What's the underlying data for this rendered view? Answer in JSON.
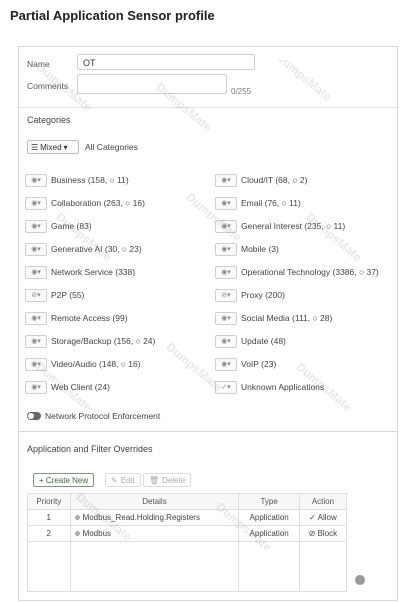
{
  "page": {
    "title": "Partial Application Sensor profile"
  },
  "form": {
    "name_label": "Name",
    "name_value": "OT",
    "comments_label": "Comments",
    "comments_counter": "0/255"
  },
  "categories": {
    "section_label": "Categories",
    "mixed_label": "Mixed",
    "all_label": "All Categories",
    "left": [
      {
        "label": "Business (158, ○ 11)",
        "icon": "eye-icon"
      },
      {
        "label": "Collaboration (263, ○ 16)",
        "icon": "eye-icon"
      },
      {
        "label": "Game (83)",
        "icon": "eye-icon"
      },
      {
        "label": "Generative AI (30, ○ 23)",
        "icon": "eye-icon"
      },
      {
        "label": "Network Service (338)",
        "icon": "eye-icon"
      },
      {
        "label": "P2P (55)",
        "icon": "block-icon"
      },
      {
        "label": "Remote Access (99)",
        "icon": "eye-icon"
      },
      {
        "label": "Storage/Backup (156, ○ 24)",
        "icon": "eye-icon"
      },
      {
        "label": "Video/Audio (148, ○ 16)",
        "icon": "eye-icon"
      },
      {
        "label": "Web Client (24)",
        "icon": "eye-icon"
      }
    ],
    "right": [
      {
        "label": "Cloud/IT (68, ○ 2)",
        "icon": "eye-icon"
      },
      {
        "label": "Email (76, ○ 11)",
        "icon": "eye-icon"
      },
      {
        "label": "General Interest (235, ○ 11)",
        "icon": "eye-icon"
      },
      {
        "label": "Mobile (3)",
        "icon": "eye-icon"
      },
      {
        "label": "Operational Technology (3386, ○ 37)",
        "icon": "eye-icon"
      },
      {
        "label": "Proxy (200)",
        "icon": "block-icon"
      },
      {
        "label": "Social Media (111, ○ 28)",
        "icon": "eye-icon"
      },
      {
        "label": "Update (48)",
        "icon": "eye-icon"
      },
      {
        "label": "VoIP (23)",
        "icon": "eye-icon"
      },
      {
        "label": "Unknown Applications",
        "icon": "check-icon"
      }
    ]
  },
  "protocol": {
    "label": "Network Protocol Enforcement"
  },
  "overrides": {
    "section_label": "Application and Filter Overrides",
    "create_label": "+ Create New",
    "edit_label": "Edit",
    "delete_label": "Delete",
    "columns": [
      "Priority",
      "Details",
      "Type",
      "Action"
    ],
    "rows": [
      {
        "priority": "1",
        "details": "Modbus_Read.Holding.Registers",
        "type": "Application",
        "action": "✓ Allow"
      },
      {
        "priority": "2",
        "details": "Modbus",
        "type": "Application",
        "action": "⊘ Block"
      }
    ]
  },
  "icons": {
    "eye": "◉",
    "block": "⊘",
    "check": "✓"
  }
}
